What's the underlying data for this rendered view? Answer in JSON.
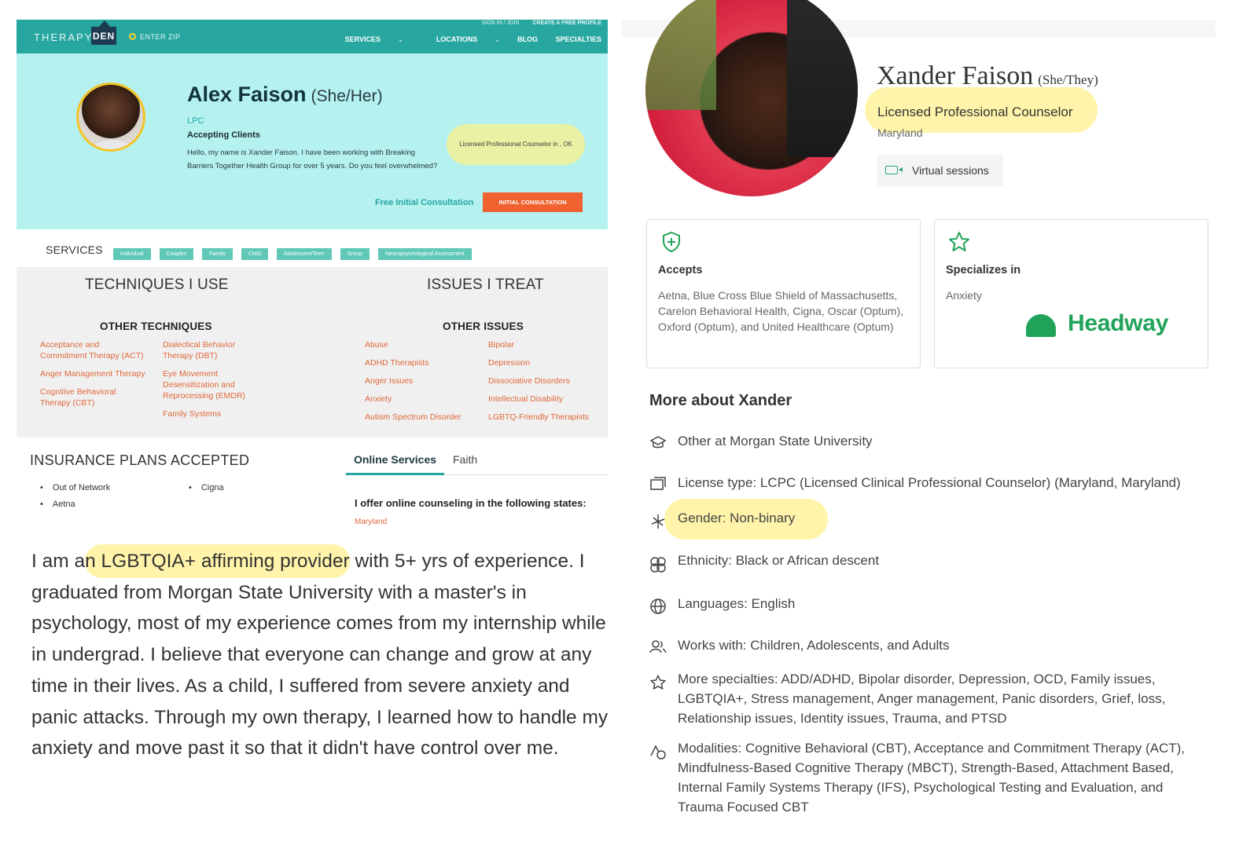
{
  "left": {
    "nav": {
      "logo_text": "THERAPY",
      "logo_badge": "DEN",
      "zip_placeholder": "ENTER ZIP",
      "sign_in": "SIGN IN / JOIN",
      "create_profile": "CREATE A FREE PROFILE",
      "items": [
        "SERVICES",
        "LOCATIONS",
        "BLOG",
        "SPECIALTIES"
      ]
    },
    "hero": {
      "name": "Alex Faison",
      "pronouns": "(She/Her)",
      "credential": "LPC",
      "status": "Accepting Clients",
      "bio": "Hello, my name is Xander Faison. I have been working with Breaking Barriers Together Health Group for over 5 years. Do you feel overwhelmed?",
      "license": "Licensed Professional Counselor in , OK",
      "free_consult": "Free Initial Consultation",
      "consult_button": "INITIAL CONSULTATION"
    },
    "services": {
      "title": "SERVICES",
      "chips": [
        "Individual",
        "Couples",
        "Family",
        "Child",
        "Adolescent/Teen",
        "Group",
        "Neuropsychological Assessment"
      ]
    },
    "techniques": {
      "title": "TECHNIQUES I USE",
      "subtitle": "OTHER TECHNIQUES",
      "col1": [
        "Acceptance and Commitment Therapy (ACT)",
        "Anger Management Therapy",
        "Cognitive Behavioral Therapy (CBT)"
      ],
      "col2": [
        "Dialectical Behavior Therapy (DBT)",
        "Eye Movement Desensitization and Reprocessing (EMDR)",
        "Family Systems"
      ]
    },
    "issues": {
      "title": "ISSUES I TREAT",
      "subtitle": "OTHER ISSUES",
      "col1": [
        "Abuse",
        "ADHD Therapists",
        "Anger Issues",
        "Anxiety",
        "Autism Spectrum Disorder"
      ],
      "col2": [
        "Bipolar",
        "Depression",
        "Dissociative Disorders",
        "Intellectual Disability",
        "LGBTQ-Friendly Therapists"
      ]
    },
    "insurance": {
      "title": "INSURANCE PLANS ACCEPTED",
      "col1": [
        "Out of Network",
        "Aetna"
      ],
      "col2": [
        "Cigna"
      ]
    },
    "tabs": {
      "active": "Online Services",
      "inactive": "Faith"
    },
    "online": {
      "text": "I offer online counseling in the following states:",
      "state": "Maryland"
    },
    "bio_long": {
      "pre": "I am a",
      "highlight": "n LGBTQIA+ affirming provider",
      "post": " with 5+ yrs of experience. I graduated from Morgan State University with a master's in psychology, most of my experience comes from my internship while in undergrad. I believe that everyone can change and grow at any time in their lives. As a child, I suffered from severe anxiety and panic attacks. Through my own therapy, I learned how to handle my anxiety and move past it so that it didn't have control over me."
    }
  },
  "right": {
    "name": "Xander Faison",
    "pronouns": "(She/They)",
    "title": "Licensed Professional Counselor",
    "location": "Maryland",
    "virtual": "Virtual sessions",
    "accepts": {
      "title": "Accepts",
      "body": "Aetna, Blue Cross Blue Shield of Massachusetts, Carelon Behavioral Health, Cigna, Oscar (Optum), Oxford (Optum), and United Healthcare (Optum)"
    },
    "specializes": {
      "title": "Specializes in",
      "body": "Anxiety",
      "brand": "Headway"
    },
    "more": {
      "title": "More about Xander",
      "items": [
        {
          "icon": "graduation-cap-icon",
          "text": "Other at Morgan State University"
        },
        {
          "icon": "license-card-icon",
          "text": "License type: LCPC (Licensed Clinical Professional Counselor) (Maryland, Maryland)"
        },
        {
          "icon": "gender-icon",
          "text": "Gender: Non-binary"
        },
        {
          "icon": "ethnicity-icon",
          "text": "Ethnicity: Black or African descent"
        },
        {
          "icon": "globe-icon",
          "text": "Languages: English"
        },
        {
          "icon": "people-icon",
          "text": "Works with: Children, Adolescents, and Adults"
        },
        {
          "icon": "star-outline-icon",
          "text": "More specialties: ADD/ADHD, Bipolar disorder, Depression, OCD, Family issues, LGBTQIA+, Stress management, Anger management, Panic disorders, Grief, loss, Relationship issues, Identity issues, Trauma, and PTSD"
        },
        {
          "icon": "modalities-icon",
          "text": "Modalities: Cognitive Behavioral (CBT), Acceptance and Commitment Therapy (ACT), Mindfulness-Based Cognitive Therapy (MBCT), Strength-Based, Attachment Based, Internal Family Systems Therapy (IFS), Psychological Testing and Evaluation, and Trauma Focused CBT"
        }
      ]
    }
  },
  "colors": {
    "teal": "#27a7a0",
    "hero_bg": "#b4f1ef",
    "orange": "#f0622f",
    "highlight": "#fff08c",
    "headway_green": "#21a35a"
  }
}
